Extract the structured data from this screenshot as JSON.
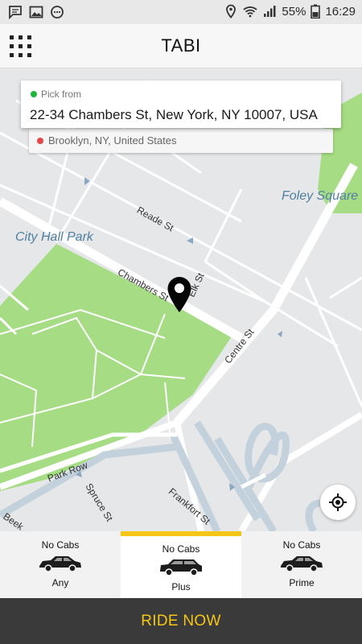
{
  "status_bar": {
    "battery": "55%",
    "time": "16:29",
    "icons": [
      "message-icon",
      "image-icon",
      "chat-bubble-icon",
      "location-icon",
      "wifi-icon",
      "signal-icon",
      "battery-icon"
    ]
  },
  "app_bar": {
    "title": "TABI",
    "menu_icon": "grid-menu-icon"
  },
  "pickup": {
    "label": "Pick from",
    "address": "22-34 Chambers St, New York, NY 10007, USA",
    "dot_color": "#1fb53c"
  },
  "dropoff": {
    "address": "Brooklyn, NY, United States",
    "dot_color": "#e54646"
  },
  "map": {
    "labels": {
      "foley": "Foley Square",
      "city_hall": "City Hall Park",
      "reade": "Reade St",
      "chambers": "Chambers St",
      "elk": "Elk St",
      "centre": "Centre St",
      "park_row": "Park Row",
      "spruce": "Spruce St",
      "frankfort": "Frankfort St",
      "beekman": "Beek"
    },
    "pin_icon": "map-pin-icon",
    "locate_icon": "my-location-icon"
  },
  "cabs": [
    {
      "status": "No Cabs",
      "name": "Any",
      "selected": false
    },
    {
      "status": "No Cabs",
      "name": "Plus",
      "selected": true
    },
    {
      "status": "No Cabs",
      "name": "Prime",
      "selected": false
    }
  ],
  "ride_button": "RIDE NOW",
  "colors": {
    "accent": "#f5c518",
    "park": "#a5dc84",
    "road": "#ffffff",
    "water_road": "#c2d1dc",
    "bottom_bar": "#3a3a3a"
  }
}
